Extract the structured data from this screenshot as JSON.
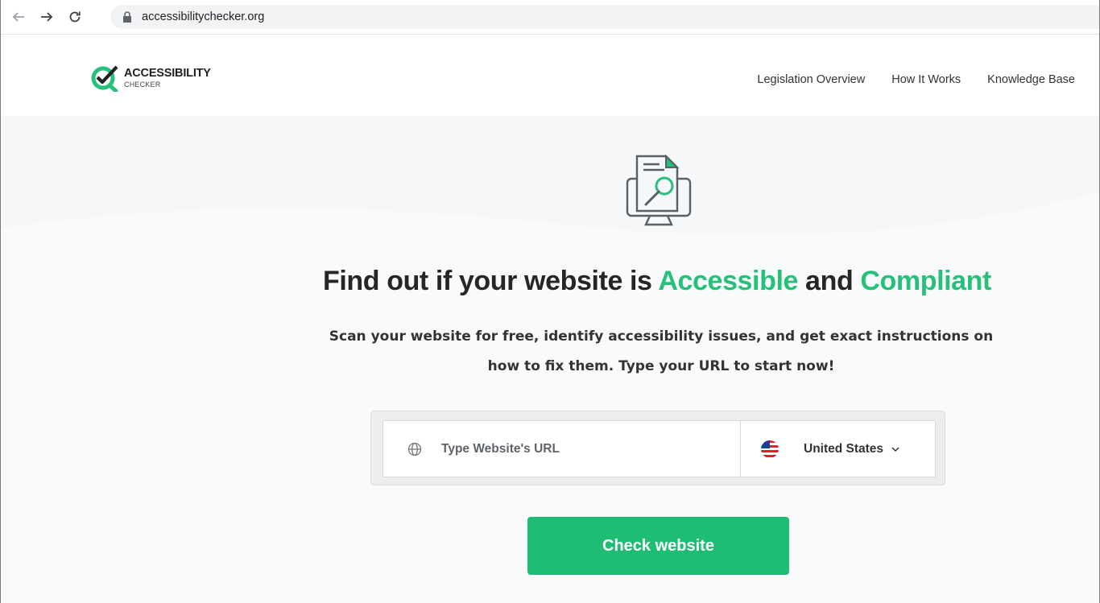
{
  "browser": {
    "url": "accessibilitychecker.org"
  },
  "site": {
    "logo_title": "ACCESSIBILITY",
    "logo_sub": "CHECKER",
    "nav": [
      {
        "label": "Legislation Overview"
      },
      {
        "label": "How It Works"
      },
      {
        "label": "Knowledge Base"
      }
    ]
  },
  "hero": {
    "headline_part1": "Find out if your website is ",
    "headline_accent1": "Accessible",
    "headline_part2": " and ",
    "headline_accent2": "Compliant",
    "subtitle_line1": "Scan your website for free, identify accessibility issues, and get exact instructions on",
    "subtitle_line2": "how to fix them. Type your URL to start now!",
    "url_placeholder": "Type Website's URL",
    "country": "United States",
    "button_label": "Check website",
    "icons": {
      "globe": "globe-icon",
      "flag": "us-flag-icon",
      "dropdown": "chevron-down-icon",
      "illustration": "document-search-monitor-icon"
    }
  },
  "colors": {
    "accent": "#27c07a",
    "button": "#1fbd73",
    "hero_bg": "#f6f7f8"
  }
}
